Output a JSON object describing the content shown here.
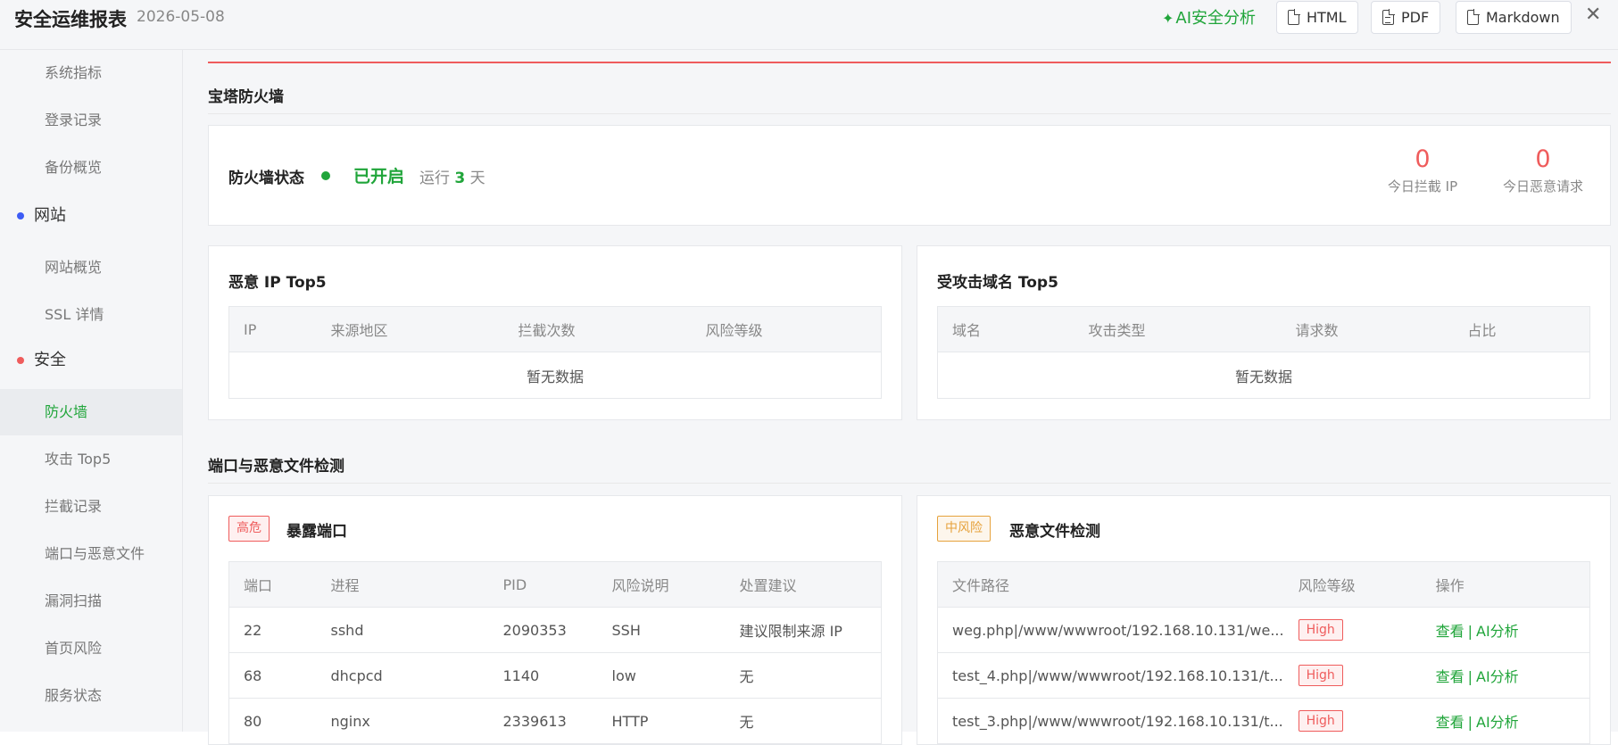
{
  "header": {
    "title": "安全运维报表",
    "date": "2026-05-08",
    "ai_label": "AI安全分析",
    "exports": [
      "HTML",
      "PDF",
      "Markdown"
    ],
    "close": "✕"
  },
  "sidebar": {
    "items": [
      {
        "label": "系统指标"
      },
      {
        "label": "登录记录"
      },
      {
        "label": "备份概览"
      },
      {
        "label": "网站",
        "group": true,
        "dot": "#3d5cf5"
      },
      {
        "label": "网站概览"
      },
      {
        "label": "SSL 详情"
      },
      {
        "label": "安全",
        "group": true,
        "dot": "#ef5c5c"
      },
      {
        "label": "防火墙",
        "active": true
      },
      {
        "label": "攻击 Top5"
      },
      {
        "label": "拦截记录"
      },
      {
        "label": "端口与恶意文件"
      },
      {
        "label": "漏洞扫描"
      },
      {
        "label": "首页风险"
      },
      {
        "label": "服务状态"
      }
    ]
  },
  "firewall": {
    "section_title": "宝塔防火墙",
    "status_label": "防火墙状态",
    "status_value": "已开启",
    "run_prefix": "运行",
    "run_days": "3",
    "run_suffix": "天",
    "stats": [
      {
        "value": "0",
        "label": "今日拦截 IP"
      },
      {
        "value": "0",
        "label": "今日恶意请求"
      }
    ]
  },
  "malicious_ip": {
    "title": "恶意 IP Top5",
    "columns": [
      "IP",
      "来源地区",
      "拦截次数",
      "风险等级"
    ],
    "empty": "暂无数据"
  },
  "attacked_domain": {
    "title": "受攻击域名 Top5",
    "columns": [
      "域名",
      "攻击类型",
      "请求数",
      "占比"
    ],
    "empty": "暂无数据"
  },
  "port_file": {
    "section_title": "端口与恶意文件检测",
    "ports": {
      "tag": "高危",
      "title": "暴露端口",
      "columns": [
        "端口",
        "进程",
        "PID",
        "风险说明",
        "处置建议"
      ],
      "rows": [
        [
          "22",
          "sshd",
          "2090353",
          "SSH",
          "建议限制来源 IP"
        ],
        [
          "68",
          "dhcpcd",
          "1140",
          "low",
          "无"
        ],
        [
          "80",
          "nginx",
          "2339613",
          "HTTP",
          "无"
        ]
      ]
    },
    "files": {
      "tag": "中风险",
      "title": "恶意文件检测",
      "columns": [
        "文件路径",
        "风险等级",
        "操作"
      ],
      "view_label": "查看",
      "ai_label": "AI分析",
      "sep": "|",
      "rows": [
        {
          "path": "weg.php|/www/wwwroot/192.168.10.131/we...",
          "risk": "High"
        },
        {
          "path": "test_4.php|/www/wwwroot/192.168.10.131/t...",
          "risk": "High"
        },
        {
          "path": "test_3.php|/www/wwwroot/192.168.10.131/t...",
          "risk": "High"
        }
      ]
    }
  }
}
